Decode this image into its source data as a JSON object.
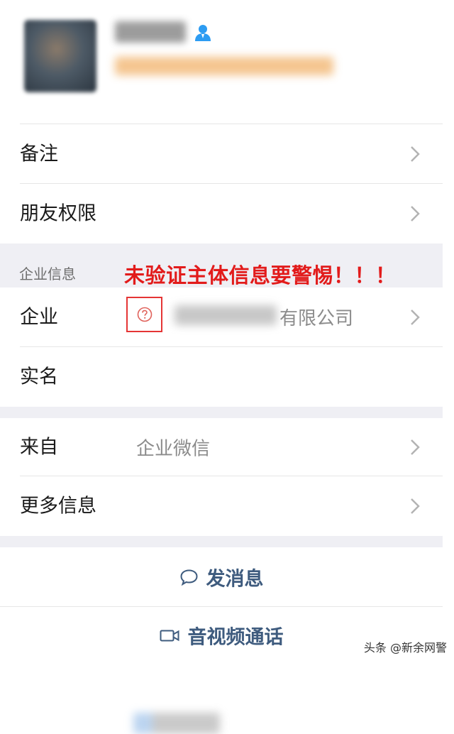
{
  "profile": {
    "icon": "person-icon",
    "colors": {
      "icon": "#2d9cf2"
    }
  },
  "rows": {
    "remark": {
      "label": "备注"
    },
    "permissions": {
      "label": "朋友权限"
    },
    "company": {
      "label": "企业",
      "suffix": "有限公司",
      "icon": "question-circle-icon"
    },
    "realname": {
      "label": "实名"
    },
    "source": {
      "label": "来自",
      "value": "企业微信"
    },
    "more": {
      "label": "更多信息"
    }
  },
  "section": {
    "title": "企业信息",
    "warning": "未验证主体信息要警惕！！！",
    "colors": {
      "warning": "#e21b1b"
    }
  },
  "actions": {
    "message": {
      "label": "发消息",
      "icon": "chat-bubble-icon"
    },
    "call": {
      "label": "音视频通话",
      "icon": "video-camera-icon"
    },
    "colors": {
      "action": "#3e5b7e"
    }
  },
  "watermark": "头条 @新余网警"
}
